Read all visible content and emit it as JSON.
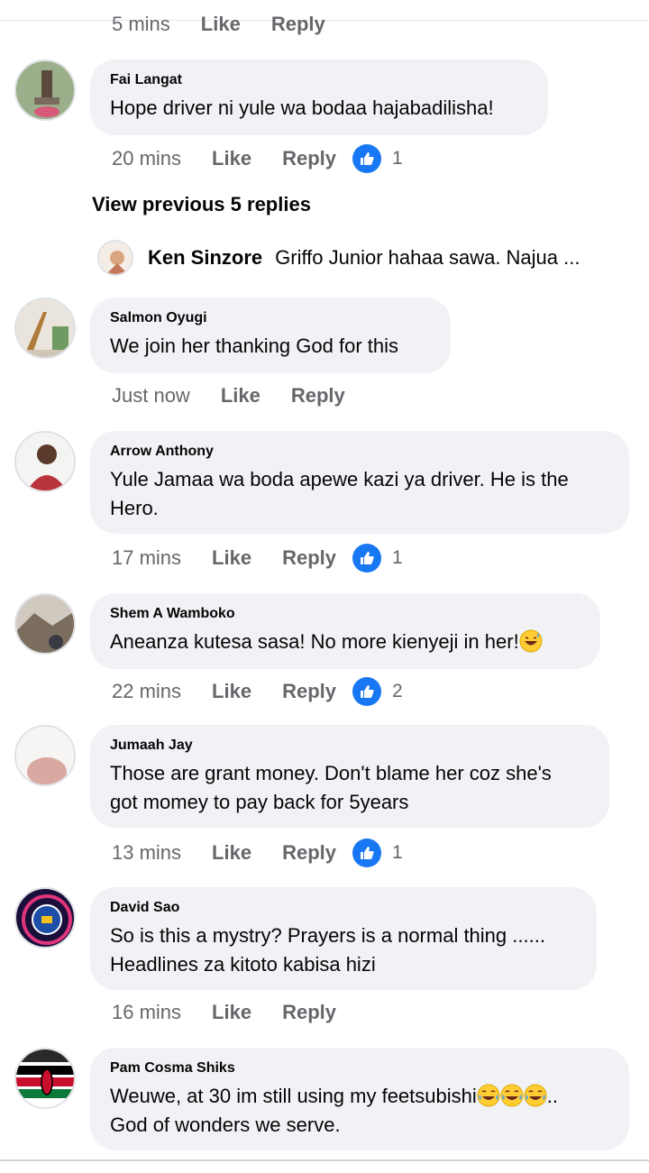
{
  "top_meta": {
    "time": "5 mins",
    "like": "Like",
    "reply": "Reply"
  },
  "view_previous": "View previous 5 replies",
  "reply_preview": {
    "name": "Ken Sinzore",
    "text": "Griffo Junior hahaa sawa. Najua ..."
  },
  "comments": [
    {
      "name": "Fai Langat",
      "text": "Hope driver ni yule wa bodaa hajabadilisha!",
      "time": "20 mins",
      "like": "Like",
      "reply": "Reply",
      "likes": "1"
    },
    {
      "name": "Salmon Oyugi",
      "text": "We join her thanking  God for this",
      "time": "Just now",
      "like": "Like",
      "reply": "Reply",
      "likes": ""
    },
    {
      "name": "Arrow Anthony",
      "text_line1": "Yule Jamaa wa boda apewe kazi ya driver. He is the",
      "text_line2": "Hero.",
      "time": "17 mins",
      "like": "Like",
      "reply": "Reply",
      "likes": "1"
    },
    {
      "name": "Shem A Wamboko",
      "text": "Aneanza kutesa sasa! No more kienyeji in her!",
      "time": "22 mins",
      "like": "Like",
      "reply": "Reply",
      "likes": "2"
    },
    {
      "name": "Jumaah Jay",
      "text_line1": "Those are grant money. Don't blame her coz she's",
      "text_line2": "got momey to pay back for 5years",
      "time": "13 mins",
      "like": "Like",
      "reply": "Reply",
      "likes": "1"
    },
    {
      "name": "David Sao",
      "text_line1": "So is this a mystry? Prayers is a normal thing ......",
      "text_line2": "Headlines za kitoto kabisa hizi",
      "time": "16 mins",
      "like": "Like",
      "reply": "Reply",
      "likes": ""
    },
    {
      "name": "Pam Cosma Shiks",
      "text_line1": "Weuwe, at 30 im still using my feetsubishi",
      "text_line1_tail": "..",
      "text_line2": "God of wonders we serve."
    }
  ],
  "icons": {
    "like_reaction": "thumbs-up-icon",
    "laugh_emoji": "grinning-sweat-emoji",
    "tears_emoji": "tears-of-joy-emoji"
  },
  "colors": {
    "bubble": "#f0f2f5",
    "meta_text": "#65676b",
    "like_blue": "#1877f2"
  }
}
